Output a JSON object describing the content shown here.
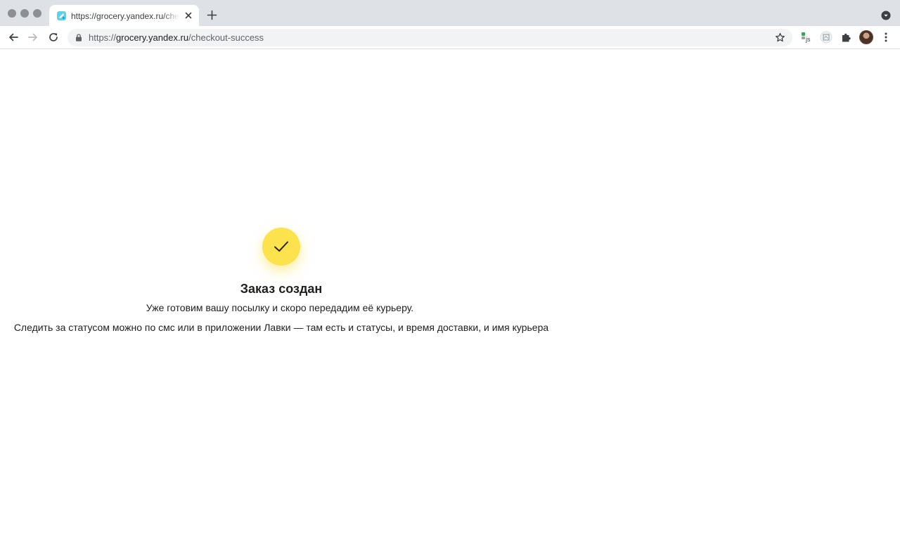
{
  "browser": {
    "tab": {
      "title": "https://grocery.yandex.ru/checkout-success",
      "favicon": "yandex-lavka-favicon"
    },
    "address_bar": {
      "scheme": "https://",
      "host": "grocery.yandex.ru",
      "path": "/checkout-success"
    },
    "icons": {
      "new_tab": "plus-icon",
      "tab_search": "chevron-down-icon",
      "back": "back-arrow-icon",
      "forward": "forward-arrow-icon",
      "reload": "reload-icon",
      "lock": "lock-icon",
      "bookmark": "star-icon",
      "extensions": "puzzle-icon",
      "menu": "kebab-menu-icon"
    }
  },
  "page": {
    "status_icon": "checkmark-icon",
    "accent_color": "#fce24c",
    "title": "Заказ создан",
    "subtitle": "Уже готовим вашу посылку и скоро передадим её курьеру.",
    "note": "Следить за статусом можно по смс или в приложении Лавки — там есть и статусы, и время доставки, и имя курьера"
  }
}
